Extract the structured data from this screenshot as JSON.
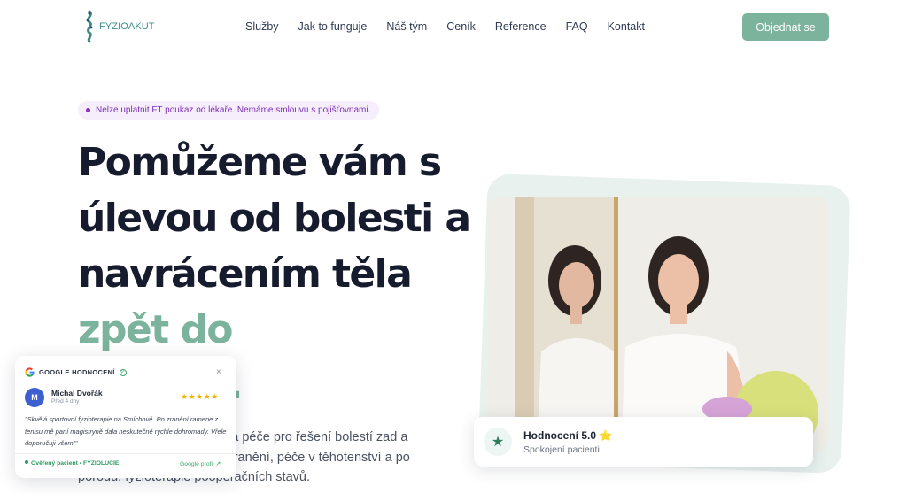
{
  "brand": {
    "name": "FYZIOAKUT",
    "accent": "#7bb39c"
  },
  "nav": {
    "items": [
      "Služby",
      "Jak to funguje",
      "Náš tým",
      "Ceník",
      "Reference",
      "FAQ",
      "Kontakt"
    ],
    "cta": "Objednat se"
  },
  "hero": {
    "notice": "Nelze uplatnit FT poukaz od lékaře. Nemáme smlouvu s pojišťovnami.",
    "headline_lines": [
      "Pomůžeme vám s",
      "úlevou od bolesti a",
      "navrácením těla"
    ],
    "headline_accent_lines": [
      "zpět do",
      "pohody."
    ],
    "subtext": "Komplexní fyzioterapeutická péče pro řešení bolestí zad a kloubů, léčbě sportovních zranění, péče v těhotenství a po porodu, fyzioterapie pooperačních stavů."
  },
  "rating_card": {
    "icon": "star-icon",
    "title": "Hodnocení 5.0 ⭐",
    "subtitle": "Spokojení pacienti"
  },
  "review_widget": {
    "header": "GOOGLE HODNOCENÍ",
    "close": "×",
    "avatar_initial": "M",
    "reviewer": "Michal Dvořák",
    "time": "Před 4 dny",
    "stars": "★★★★★",
    "text": "\"Skvělá sportovní fyzioterapie na Smíchově. Po zranění ramene z tenisu mě paní magistryně dala neskutečně rychle dohromady. Vřele doporučuji všem!\"",
    "verified": "Ověřený pacient • FYZIOLUCIE",
    "link": "Google profil ↗"
  }
}
